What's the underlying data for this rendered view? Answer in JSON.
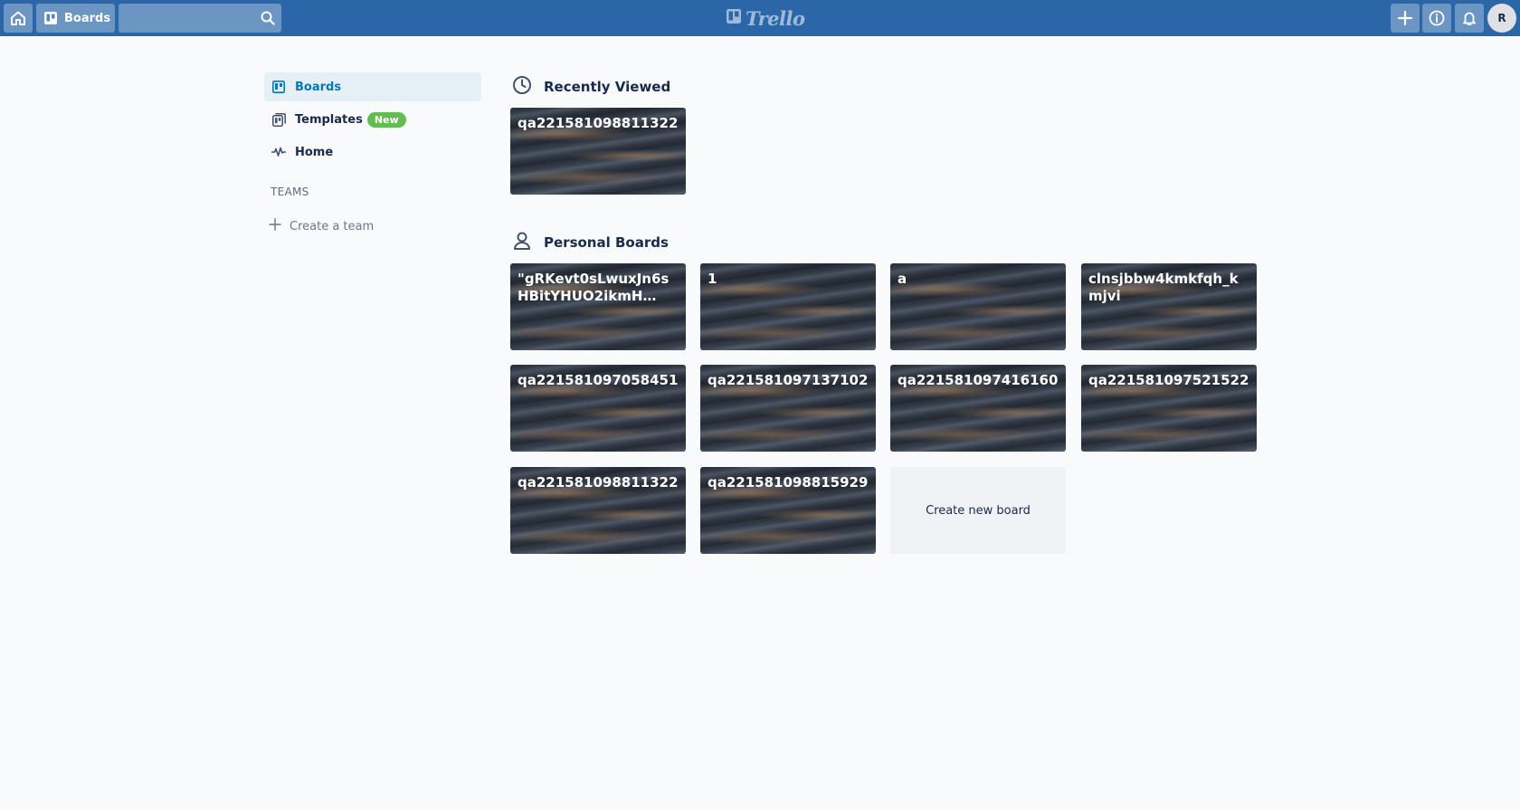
{
  "header": {
    "boards_label": "Boards",
    "search_placeholder": "",
    "logo_text": "Trello",
    "avatar_initial": "R"
  },
  "sidebar": {
    "items": [
      {
        "label": "Boards",
        "active": true,
        "icon": "board-icon"
      },
      {
        "label": "Templates",
        "badge": "New",
        "icon": "template-icon"
      },
      {
        "label": "Home",
        "icon": "activity-icon"
      }
    ],
    "teams_heading": "TEAMS",
    "create_team_label": "Create a team"
  },
  "main": {
    "recent": {
      "heading": "Recently Viewed",
      "boards": [
        "qa221581098811322"
      ]
    },
    "personal": {
      "heading": "Personal Boards",
      "boards": [
        "\"gRKevt0sLwuxJn6sHBitYHUO2ikmH…",
        "1",
        "a",
        "clnsjbbw4kmkfqh_kmjvi",
        "qa221581097058451",
        "qa221581097137102",
        "qa221581097416160",
        "qa221581097521522",
        "qa221581098811322",
        "qa221581098815929"
      ],
      "create_label": "Create new board"
    }
  },
  "colors": {
    "header_bg": "#2b67a8",
    "active_bg": "#e4f0f6",
    "active_text": "#0079bf",
    "badge_bg": "#61bd4f",
    "page_bg": "#f9fafc"
  }
}
